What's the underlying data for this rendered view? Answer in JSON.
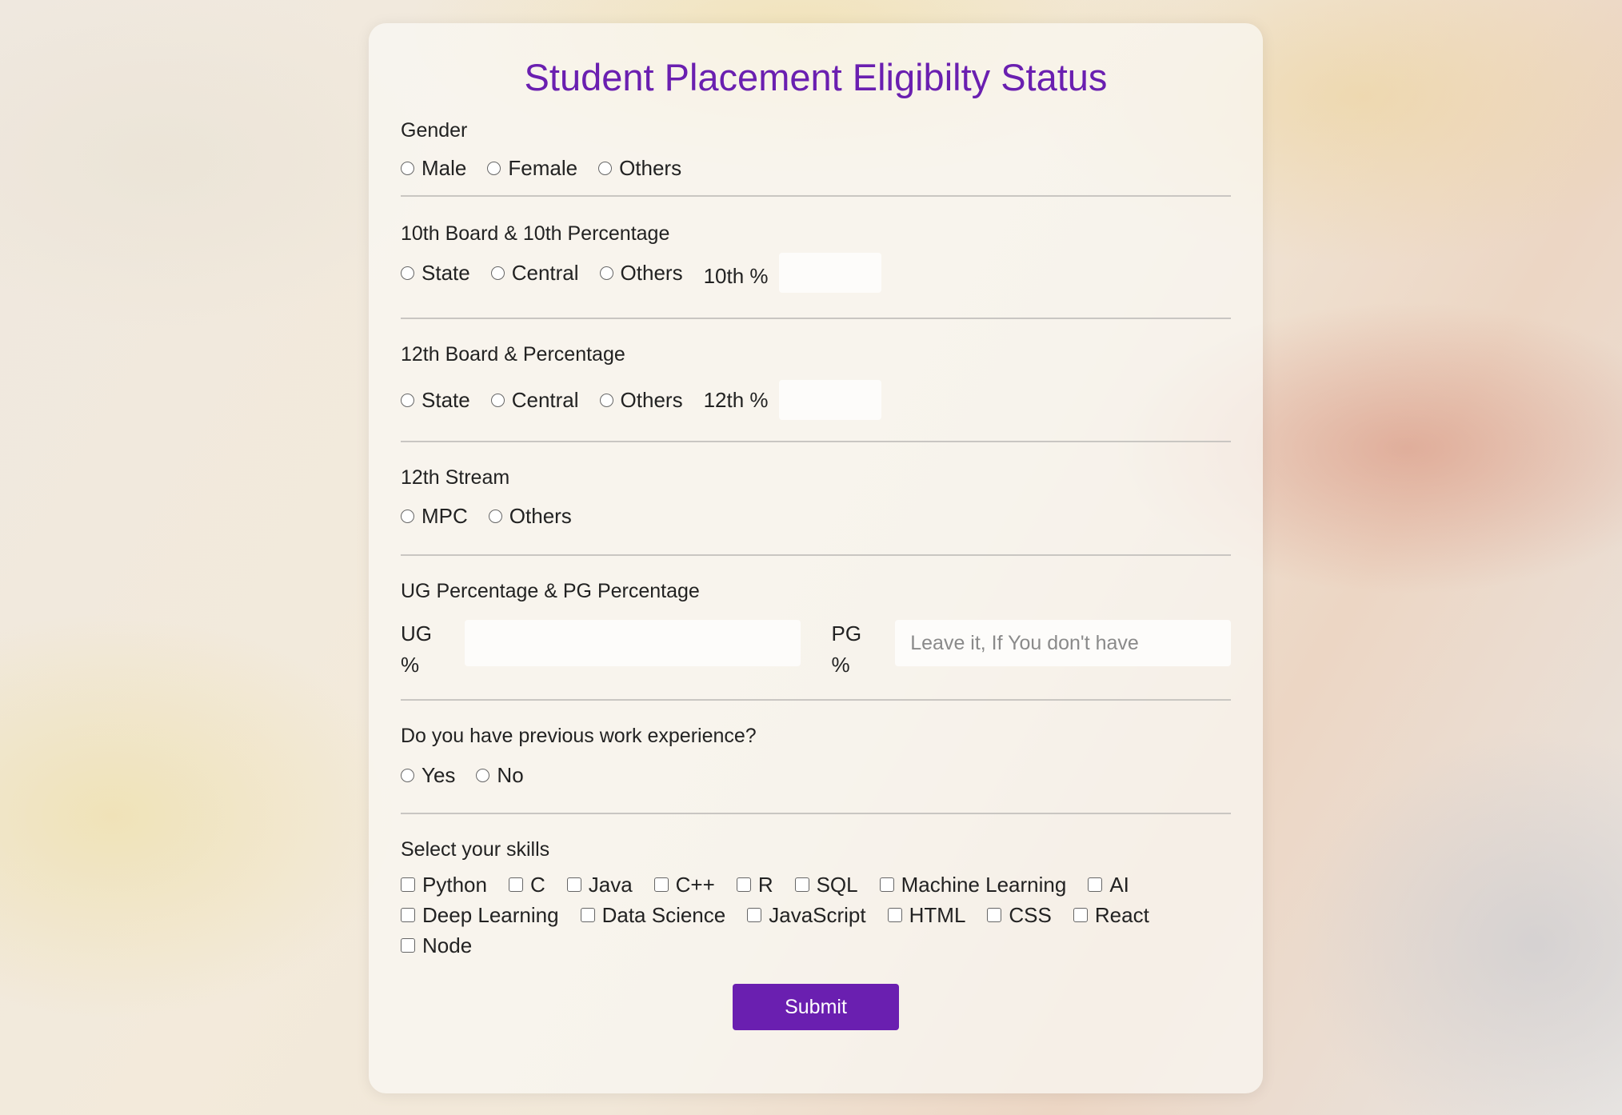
{
  "form": {
    "title": "Student Placement Eligibilty Status",
    "gender": {
      "label": "Gender",
      "options": [
        "Male",
        "Female",
        "Others"
      ]
    },
    "tenth": {
      "label": "10th Board & 10th Percentage",
      "options": [
        "State",
        "Central",
        "Others"
      ],
      "pct_label": "10th %"
    },
    "twelfth": {
      "label": "12th Board & Percentage",
      "options": [
        "State",
        "Central",
        "Others"
      ],
      "pct_label": "12th %"
    },
    "stream": {
      "label": "12th Stream",
      "options": [
        "MPC",
        "Others"
      ]
    },
    "ugpg": {
      "label": "UG Percentage & PG Percentage",
      "ug_label_1": "UG",
      "ug_label_2": "%",
      "pg_label_1": "PG",
      "pg_label_2": "%",
      "pg_placeholder": "Leave it, If You don't have"
    },
    "experience": {
      "label": "Do you have previous work experience?",
      "options": [
        "Yes",
        "No"
      ]
    },
    "skills": {
      "label": "Select your skills",
      "options": [
        "Python",
        "C",
        "Java",
        "C++",
        "R",
        "SQL",
        "Machine Learning",
        "AI",
        "Deep Learning",
        "Data Science",
        "JavaScript",
        "HTML",
        "CSS",
        "React",
        "Node"
      ]
    },
    "submit_label": "Submit"
  }
}
